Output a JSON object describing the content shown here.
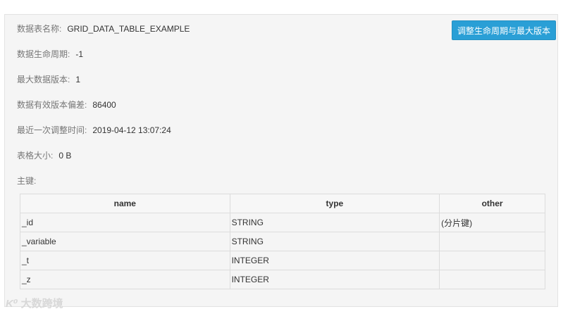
{
  "table_info": {
    "name_label": "数据表名称:",
    "name_value": "GRID_DATA_TABLE_EXAMPLE",
    "ttl_label": "数据生命周期:",
    "ttl_value": "-1",
    "max_versions_label": "最大数据版本:",
    "max_versions_value": "1",
    "deviation_label": "数据有效版本偏差:",
    "deviation_value": "86400",
    "last_adjust_label": "最近一次调整时间:",
    "last_adjust_value": "2019-04-12 13:07:24",
    "size_label": "表格大小:",
    "size_value": "0 B",
    "pk_label": "主键:"
  },
  "actions": {
    "adjust_button": "调整生命周期与最大版本"
  },
  "pk_table": {
    "headers": [
      "name",
      "type",
      "other"
    ],
    "rows": [
      [
        "_id",
        "STRING",
        "(分片键)"
      ],
      [
        "_variable",
        "STRING",
        ""
      ],
      [
        "_t",
        "INTEGER",
        ""
      ],
      [
        "_z",
        "INTEGER",
        ""
      ]
    ]
  },
  "watermark": {
    "logo": "K⁰",
    "text": "大数跨境"
  }
}
